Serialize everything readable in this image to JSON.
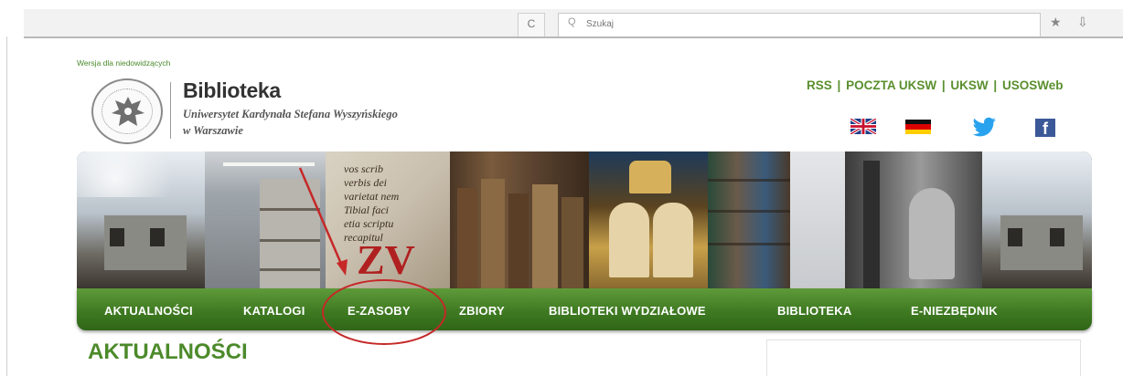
{
  "browser": {
    "reload_glyph": "C",
    "search_glyph": "Q",
    "url_placeholder": "Szukaj",
    "star_glyph": "★",
    "download_glyph": "⇩"
  },
  "header": {
    "accessibility_link": "Wersja dla niedowidzących",
    "title": "Biblioteka",
    "subtitle_line1": "Uniwersytet Kardynała Stefana Wyszyńskiego",
    "subtitle_line2": "w Warszawie",
    "top_links": [
      "RSS",
      "POCZTA UKSW",
      "UKSW",
      "USOSWeb"
    ],
    "separator": "|",
    "icons": [
      "flag-uk-icon",
      "flag-de-icon",
      "twitter-icon",
      "facebook-icon"
    ],
    "facebook_glyph": "f"
  },
  "banner": {
    "manuscript_text": "vos scrib\nverbis dei\nvarietat nem\nTibial faci\netia scriptu\nrecapitul",
    "manuscript_red": "ZV"
  },
  "nav": {
    "items": [
      "AKTUALNOŚCI",
      "KATALOGI",
      "E-ZASOBY",
      "ZBIORY",
      "BIBLIOTEKI WYDZIAŁOWE",
      "BIBLIOTEKA",
      "E-NIEZBĘDNIK"
    ],
    "highlighted": "E-ZASOBY"
  },
  "content": {
    "page_title": "AKTUALNOŚCI"
  },
  "colors": {
    "brand_green": "#4c8a2a",
    "nav_green": "#3f7a22",
    "annotation_red": "#c62828"
  }
}
